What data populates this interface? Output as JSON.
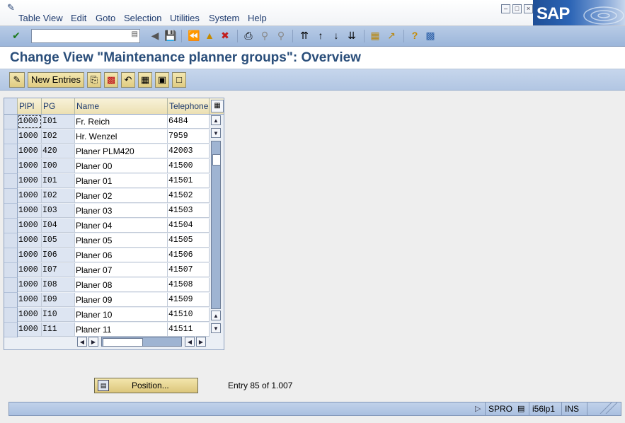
{
  "menu": {
    "items": [
      "Table View",
      "Edit",
      "Goto",
      "Selection",
      "Utilities",
      "System",
      "Help"
    ]
  },
  "window": {
    "brand": "SAP"
  },
  "toolbar": {
    "command_field_value": ""
  },
  "title": "Change View \"Maintenance planner groups\": Overview",
  "app_toolbar": {
    "new_entries_label": "New Entries"
  },
  "table": {
    "headers": [
      "PlPl",
      "PG",
      "Name",
      "Telephone"
    ],
    "rows": [
      [
        "1000",
        "I01",
        "Fr. Reich",
        "6484"
      ],
      [
        "1000",
        "I02",
        "Hr. Wenzel",
        "7959"
      ],
      [
        "1000",
        "420",
        "Planer PLM420",
        "42003"
      ],
      [
        "1000",
        "I00",
        "Planer 00",
        "41500"
      ],
      [
        "1000",
        "I01",
        "Planer 01",
        "41501"
      ],
      [
        "1000",
        "I02",
        "Planer 02",
        "41502"
      ],
      [
        "1000",
        "I03",
        "Planer 03",
        "41503"
      ],
      [
        "1000",
        "I04",
        "Planer 04",
        "41504"
      ],
      [
        "1000",
        "I05",
        "Planer 05",
        "41505"
      ],
      [
        "1000",
        "I06",
        "Planer 06",
        "41506"
      ],
      [
        "1000",
        "I07",
        "Planer 07",
        "41507"
      ],
      [
        "1000",
        "I08",
        "Planer 08",
        "41508"
      ],
      [
        "1000",
        "I09",
        "Planer 09",
        "41509"
      ],
      [
        "1000",
        "I10",
        "Planer 10",
        "41510"
      ],
      [
        "1000",
        "I11",
        "Planer 11",
        "41511"
      ]
    ]
  },
  "position_button_label": "Position...",
  "entry_text": "Entry 85 of 1.007",
  "status": {
    "transaction": "SPRO",
    "server": "i56lp1",
    "mode": "INS"
  },
  "colors": {
    "title": "#2a4e7a",
    "toolbar": "#b7cbe6",
    "button": "#e0cc82",
    "key_column": "#dde5f2"
  },
  "icons": [
    "sap-logo",
    "enter-icon",
    "save-icon",
    "back-icon",
    "exit-icon",
    "cancel-icon",
    "print-icon",
    "find-icon",
    "find-next-icon",
    "first-page-icon",
    "previous-page-icon",
    "next-page-icon",
    "last-page-icon",
    "create-session-icon",
    "shortcut-icon",
    "help-icon",
    "layout-icon"
  ]
}
